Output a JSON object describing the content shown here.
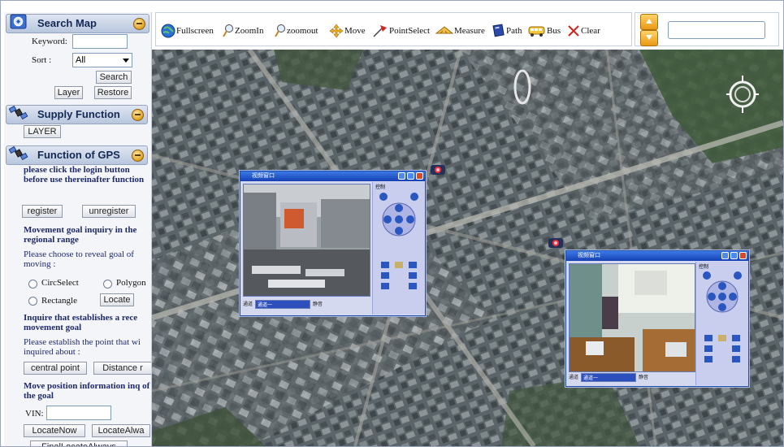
{
  "colors": {
    "sidebar_bg": "#f4f5f8",
    "header_text": "#132a55",
    "accent_blue": "#1d2a6b",
    "window_blue": "#1f4fa8",
    "map_bg": "#566066"
  },
  "search_map": {
    "title": "Search Map",
    "keyword_label": "Keyword:",
    "keyword_value": "",
    "sort_label": "Sort :",
    "sort_value": "All",
    "search_label": "Search",
    "layer_label": "Layer",
    "restore_label": "Restore"
  },
  "supply_function": {
    "title": "Supply Function",
    "layer_label": "LAYER"
  },
  "gps": {
    "title": "Function of GPS",
    "login_note": "please click the login button before use thereinafter function",
    "register_label": "register",
    "unregister_label": "unregister",
    "movement_title": "Movement goal inquiry in the regional range",
    "movement_note": "Please choose to reveal goal of moving :",
    "circ_label": "CircSelect",
    "polygon_label": "Polygon",
    "rect_label": "Rectangle",
    "locate_label": "Locate",
    "recent_title": "Inquire that establishes a rece movement goal",
    "recent_note": "Please establish the point that wi inquired about :",
    "central_label": "central point",
    "distance_label": "Distance r",
    "position_title": "Move position information inq of the goal",
    "vin_label": "VIN:",
    "vin_value": "",
    "locate_now_label": "LocateNow",
    "locate_always_label": "LocateAlwa",
    "third_button_label": "FinalLocateAlways"
  },
  "toolbar": {
    "fullscreen": "Fullscreen",
    "zoomin": "ZoomIn",
    "zoomout": "zoomout",
    "move": "Move",
    "pointselect": "PointSelect",
    "measure": "Measure",
    "path": "Path",
    "bus": "Bus",
    "clear": "Clear"
  },
  "toprightsearch": {
    "value": ""
  },
  "video_windows": [
    {
      "title": "视频窗口",
      "channel_label": "通道",
      "option": "通道一",
      "checkbox_label": "静音",
      "panel_label": "控制"
    },
    {
      "title": "视频窗口",
      "channel_label": "通道",
      "option": "通道一",
      "checkbox_label": "静音",
      "panel_label": "控制"
    }
  ],
  "icons": [
    "globe-icon",
    "zoom-in-icon",
    "zoom-out-icon",
    "move-icon",
    "pin-icon",
    "ruler-icon",
    "path-book-icon",
    "bus-icon",
    "clear-x-icon",
    "compass-icon",
    "map-marker-icon"
  ]
}
